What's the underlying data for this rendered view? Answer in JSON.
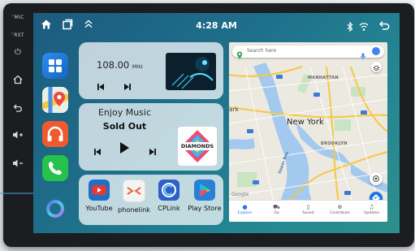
{
  "hardware": {
    "mic_label": "MIC",
    "rst_label": "RST",
    "buttons": [
      "power-icon",
      "home-icon",
      "back-icon",
      "volume-up-icon",
      "volume-down-icon"
    ]
  },
  "status_bar": {
    "time": "4:28 AM",
    "left_icons": [
      "home-icon",
      "recents-icon",
      "chevron-up-icon"
    ],
    "right_icons": [
      "bluetooth-icon",
      "signal-icon",
      "back-icon"
    ]
  },
  "dock": {
    "apps": [
      "app-grid",
      "maps",
      "music",
      "phone",
      "cortana-launcher"
    ]
  },
  "radio": {
    "frequency": "108.00",
    "unit": "MHz"
  },
  "music": {
    "title": "Enjoy Music",
    "song": "Sold Out",
    "album_art_text": "DIAMONDS"
  },
  "apps": [
    {
      "label": "YouTube",
      "color": "#e53935"
    },
    {
      "label": "phonelink",
      "color": "#f2f2f2"
    },
    {
      "label": "CPLink",
      "color": "#3b6fd8"
    },
    {
      "label": "Play Store",
      "color": "#1ba1e2"
    }
  ],
  "map": {
    "search_placeholder": "Search here",
    "city": "New York",
    "area_labels": [
      "MANHATTAN",
      "BROOKLYN"
    ],
    "partial_labels": [
      "ark",
      "Upper Bay",
      "Google"
    ],
    "nav": [
      "Explore",
      "Go",
      "Saved",
      "Contribute",
      "Updates"
    ]
  }
}
